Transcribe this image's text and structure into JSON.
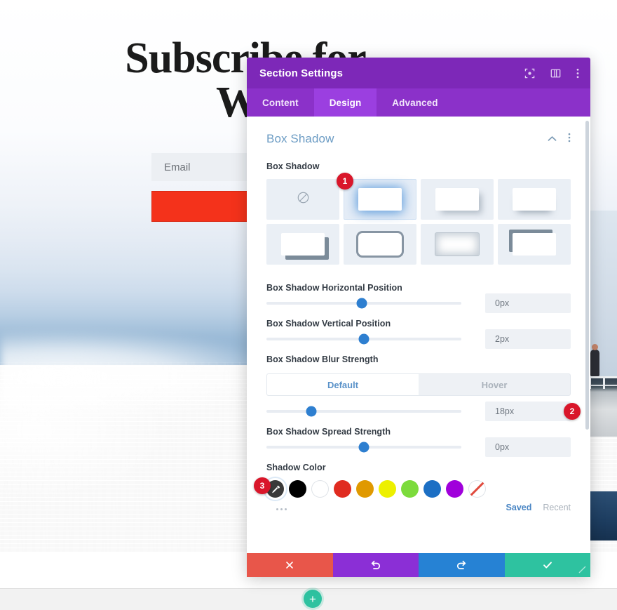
{
  "site": {
    "hero_title_line1": "Subscribe for",
    "hero_title_line2": "We",
    "email_placeholder": "Email",
    "add_section_label": "+"
  },
  "modal": {
    "title": "Section Settings",
    "title_icons": [
      "focus-target-icon",
      "panel-layout-icon",
      "overflow-menu-icon"
    ],
    "tabs": [
      {
        "label": "Content",
        "active": false
      },
      {
        "label": "Design",
        "active": true
      },
      {
        "label": "Advanced",
        "active": false
      }
    ],
    "section": {
      "heading": "Box Shadow",
      "collapse_icon": "chevron-up-icon",
      "menu_icon": "overflow-menu-icon"
    },
    "box_shadow": {
      "label": "Box Shadow",
      "presets": [
        {
          "name": "none",
          "selected": false
        },
        {
          "name": "glow",
          "selected": true
        },
        {
          "name": "drop-right",
          "selected": false
        },
        {
          "name": "drop-bottom",
          "selected": false
        },
        {
          "name": "hard-offset",
          "selected": false
        },
        {
          "name": "outline",
          "selected": false
        },
        {
          "name": "inset",
          "selected": false
        },
        {
          "name": "corner",
          "selected": false
        }
      ]
    },
    "controls": [
      {
        "label": "Box Shadow Horizontal Position",
        "value": "0px",
        "percent": 49
      },
      {
        "label": "Box Shadow Vertical Position",
        "value": "2px",
        "percent": 50
      }
    ],
    "blur": {
      "label": "Box Shadow Blur Strength",
      "states": [
        {
          "label": "Default",
          "active": true
        },
        {
          "label": "Hover",
          "active": false
        }
      ],
      "value": "18px",
      "percent": 23
    },
    "spread": {
      "label": "Box Shadow Spread Strength",
      "value": "0px",
      "percent": 50
    },
    "shadow_color": {
      "label": "Shadow Color",
      "swatches": [
        {
          "name": "eyedropper",
          "color": "#3a3a3a",
          "selected": true
        },
        {
          "name": "black",
          "color": "#000000",
          "selected": false
        },
        {
          "name": "white",
          "color": "#ffffff",
          "selected": false
        },
        {
          "name": "red",
          "color": "#e02b20",
          "selected": false
        },
        {
          "name": "orange",
          "color": "#e09900",
          "selected": false
        },
        {
          "name": "yellow",
          "color": "#edf000",
          "selected": false
        },
        {
          "name": "green",
          "color": "#7cdb3c",
          "selected": false
        },
        {
          "name": "blue",
          "color": "#1c6fc4",
          "selected": false
        },
        {
          "name": "purple",
          "color": "#a000db",
          "selected": false
        },
        {
          "name": "transparent",
          "color": "transparent",
          "selected": false
        }
      ],
      "saved_label": "Saved",
      "recent_label": "Recent"
    },
    "actions": [
      {
        "name": "cancel",
        "icon": "close-icon",
        "color": "#e8564a"
      },
      {
        "name": "undo",
        "icon": "undo-icon",
        "color": "#8b2fd6"
      },
      {
        "name": "redo",
        "icon": "redo-icon",
        "color": "#2682d4"
      },
      {
        "name": "save",
        "icon": "check-icon",
        "color": "#2ec2a0"
      }
    ]
  },
  "badges": [
    {
      "number": "1",
      "target": "box-shadow-preset-glow"
    },
    {
      "number": "2",
      "target": "blur-strength-value"
    },
    {
      "number": "3",
      "target": "shadow-color-eyedropper"
    }
  ]
}
